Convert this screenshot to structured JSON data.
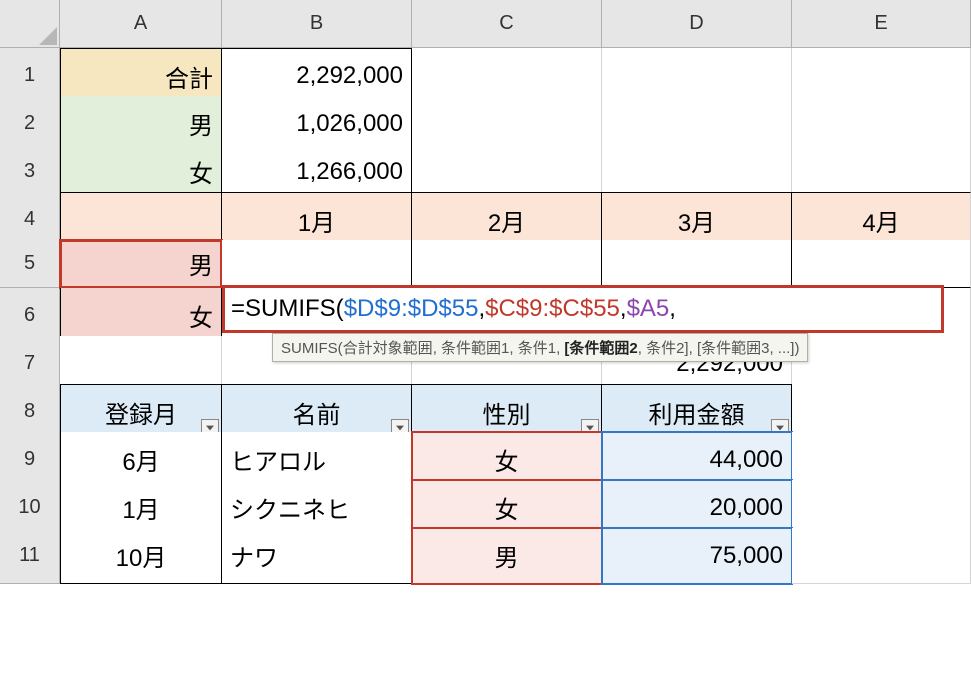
{
  "columns": [
    "A",
    "B",
    "C",
    "D",
    "E"
  ],
  "rows": [
    "1",
    "2",
    "3",
    "4",
    "5",
    "6",
    "7",
    "8",
    "9",
    "10",
    "11"
  ],
  "summary": {
    "total_label": "合計",
    "total_value": "2,292,000",
    "male_label": "男",
    "male_value": "1,026,000",
    "female_label": "女",
    "female_value": "1,266,000"
  },
  "months": {
    "m1": "1月",
    "m2": "2月",
    "m3": "3月",
    "m4": "4月"
  },
  "pivot": {
    "row5_label": "男",
    "row6_label": "女",
    "row7_total": "2,292,000"
  },
  "table": {
    "headers": {
      "month": "登録月",
      "name": "名前",
      "gender": "性別",
      "amount": "利用金額"
    },
    "rows": [
      {
        "month": "6月",
        "name": "ヒアロル",
        "gender": "女",
        "amount": "44,000"
      },
      {
        "month": "1月",
        "name": "シクニネヒ",
        "gender": "女",
        "amount": "20,000"
      },
      {
        "month": "10月",
        "name": "ナワ",
        "gender": "男",
        "amount": "75,000"
      }
    ]
  },
  "formula": {
    "prefix": "=SUMIFS(",
    "arg1": "$D$9:$D$55",
    "sep": ",",
    "arg2": "$C$9:$C$55",
    "arg3": "$A5"
  },
  "tooltip": {
    "fn": "SUMIFS(",
    "a1": "合計対象範囲",
    "a2": "条件範囲1",
    "a3": "条件1",
    "a4_bold": "[条件範囲2",
    "a5": "条件2]",
    "a6": "[条件範囲3, ...])",
    "sep": ", "
  }
}
